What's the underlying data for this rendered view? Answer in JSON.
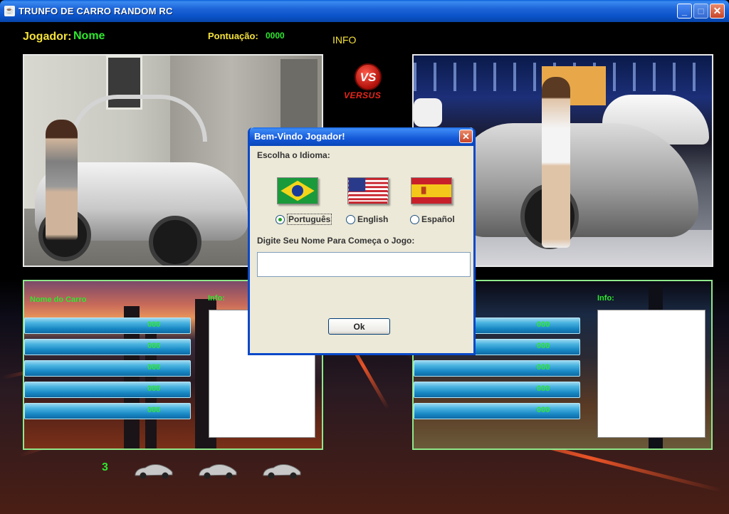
{
  "window": {
    "title": "TRUNFO DE CARRO RANDOM RC",
    "app_icon": "java-coffee-icon",
    "minimize_label": "_",
    "maximize_label": "□",
    "close_label": "✕"
  },
  "hud": {
    "player_label": "Jogador:",
    "player_name": "Nome",
    "score_label": "Pontuação:",
    "score_value": "0000",
    "info_label": "INFO"
  },
  "versus": {
    "badge": "VS",
    "text": "VERSUS"
  },
  "left_card": {
    "car_name": "Nome do Carro",
    "info_title": "Info:",
    "stats": [
      "000",
      "000",
      "000",
      "000",
      "000"
    ]
  },
  "right_card": {
    "info_title": "Info:",
    "stats": [
      "000",
      "000",
      "000",
      "000",
      "000"
    ]
  },
  "bottom": {
    "round_number": "3"
  },
  "dialog": {
    "title": "Bem-Vindo Jogador!",
    "close_label": "✕",
    "language_label": "Escolha o Idioma:",
    "languages": [
      {
        "label": "Português",
        "flag": "brazil-flag-icon",
        "selected": true
      },
      {
        "label": "English",
        "flag": "usa-flag-icon",
        "selected": false
      },
      {
        "label": "Español",
        "flag": "spain-flag-icon",
        "selected": false
      }
    ],
    "name_label": "Digite Seu Nome Para Começa o Jogo:",
    "name_value": "",
    "ok_label": "Ok"
  },
  "colors": {
    "hud_yellow": "#f4e23a",
    "hud_green": "#2ee82e",
    "panel_border": "#8fe88a",
    "xp_blue": "#0a48c8"
  }
}
